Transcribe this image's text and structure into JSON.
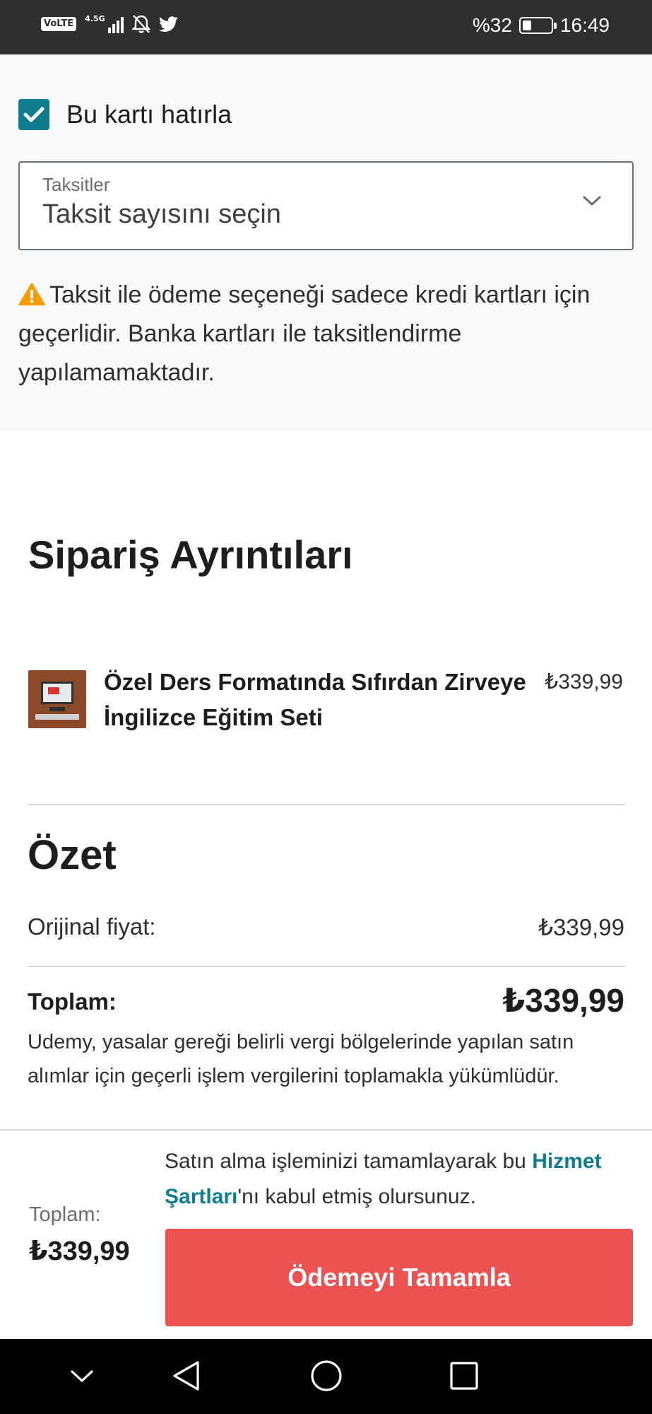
{
  "status_bar": {
    "volte": "VoLTE",
    "network": "4.5G",
    "battery_text": "%32",
    "battery_level": 0.32,
    "time": "16:49",
    "icons": [
      "volte-icon",
      "signal-icon",
      "mute-icon",
      "twitter-icon",
      "battery-icon"
    ]
  },
  "payment": {
    "remember_card_label": "Bu kartı hatırla",
    "remember_card_checked": true,
    "installments": {
      "label": "Taksitler",
      "selected": "Taksit sayısını seçin"
    },
    "warning": "Taksit ile ödeme seçeneği sadece kredi kartları için geçerlidir. Banka kartları ile taksitlendirme yapılamamaktadır."
  },
  "order": {
    "title": "Sipariş Ayrıntıları",
    "items": [
      {
        "name": "Özel Ders Formatında Sıfırdan Zirveye İngilizce Eğitim Seti",
        "price": "₺339,99"
      }
    ]
  },
  "summary": {
    "title": "Özet",
    "original_label": "Orijinal fiyat:",
    "original_value": "₺339,99",
    "total_label": "Toplam:",
    "total_value": "₺339,99",
    "tax_note": "Udemy, yasalar gereği belirli vergi bölgelerinde yapılan satın alımlar için geçerli işlem vergilerini toplamakla yükümlüdür."
  },
  "checkout": {
    "terms_prefix": "Satın alma işleminizi tamamlayarak bu ",
    "terms_link": "Hizmet Şartları",
    "terms_suffix": "'nı kabul etmiş olursunuz.",
    "total_label": "Toplam:",
    "total_value": "₺339,99",
    "button_label": "Ödemeyi Tamamla"
  },
  "colors": {
    "accent": "#0f7c90",
    "button": "#ec5252",
    "warning": "#f69c08",
    "status_bar": "#2d2f31"
  }
}
